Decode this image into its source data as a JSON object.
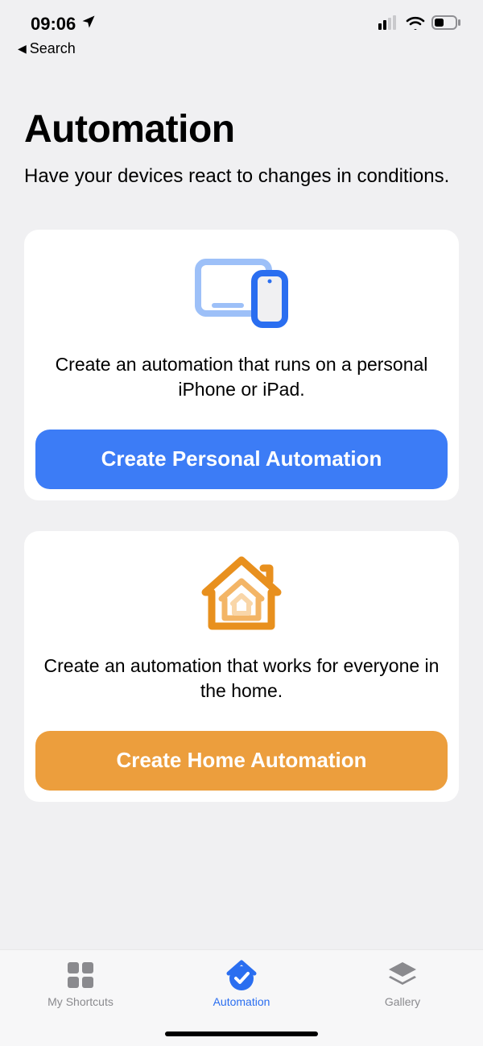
{
  "status_bar": {
    "time": "09:06",
    "back_label": "Search"
  },
  "page": {
    "title": "Automation",
    "subtitle": "Have your devices react to changes in conditions."
  },
  "cards": {
    "personal": {
      "description": "Create an automation that runs on a personal iPhone or iPad.",
      "button_label": "Create Personal Automation"
    },
    "home": {
      "description": "Create an automation that works for everyone in the home.",
      "button_label": "Create Home Automation"
    }
  },
  "tabs": {
    "shortcuts": {
      "label": "My Shortcuts"
    },
    "automation": {
      "label": "Automation"
    },
    "gallery": {
      "label": "Gallery"
    }
  },
  "colors": {
    "blue": "#3c7cf6",
    "orange": "#ec9e3d",
    "gray": "#8a8a8e"
  }
}
